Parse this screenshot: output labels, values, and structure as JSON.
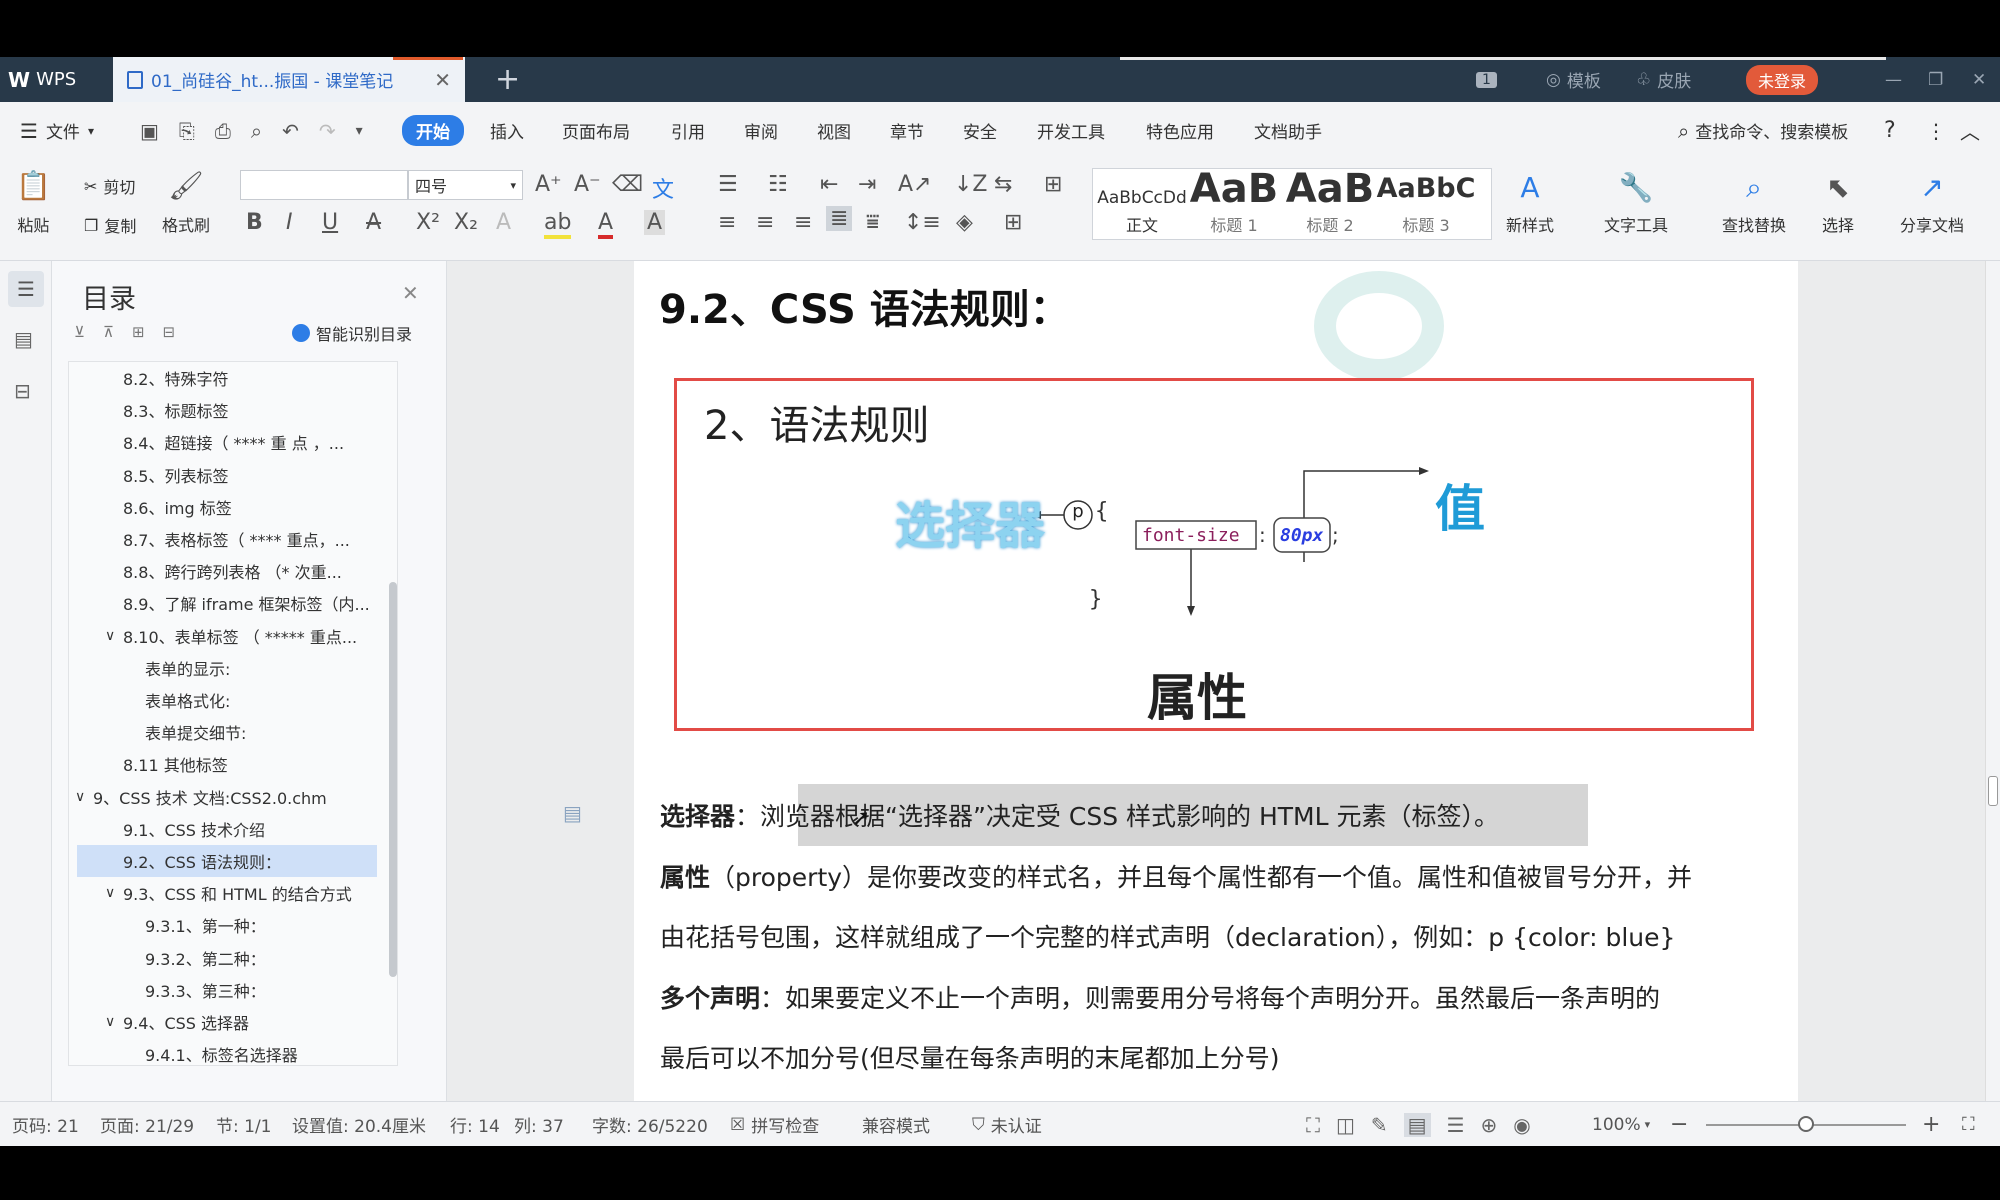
{
  "titlebar": {
    "app_name": "WPS",
    "doc_tab": "01_尚硅谷_ht...振国 - 课堂笔记",
    "new_tab": "+",
    "window_count": "1",
    "template": "模板",
    "skin": "皮肤",
    "login": "未登录"
  },
  "menubar": {
    "file": "文件",
    "tabs": [
      "开始",
      "插入",
      "页面布局",
      "引用",
      "审阅",
      "视图",
      "章节",
      "安全",
      "开发工具",
      "特色应用",
      "文档助手"
    ],
    "search": "查找命令、搜索模板",
    "help": "?"
  },
  "ribbon": {
    "paste": "粘贴",
    "cut": "剪切",
    "copy": "复制",
    "format_painter": "格式刷",
    "font_name": "",
    "font_size": "四号",
    "styles": [
      {
        "preview": "AaBbCcDd",
        "label": "正文"
      },
      {
        "preview": "AaB",
        "label": "标题 1"
      },
      {
        "preview": "AaB",
        "label": "标题 2"
      },
      {
        "preview": "AaBbC",
        "label": "标题 3"
      }
    ],
    "new_style": "新样式",
    "text_tools": "文字工具",
    "find_replace": "查找替换",
    "select": "选择",
    "share": "分享文档"
  },
  "toc": {
    "title": "目录",
    "smart": "智能识别目录",
    "items": [
      {
        "label": "8.2、特殊字符",
        "level": 2
      },
      {
        "label": "8.3、标题标签",
        "level": 2
      },
      {
        "label": "8.4、超链接（ **** 重 点 ，...",
        "level": 2
      },
      {
        "label": "8.5、列表标签",
        "level": 2
      },
      {
        "label": "8.6、img 标签",
        "level": 2
      },
      {
        "label": "8.7、表格标签（ **** 重点，...",
        "level": 2
      },
      {
        "label": "8.8、跨行跨列表格 （* 次重...",
        "level": 2
      },
      {
        "label": "8.9、了解 iframe 框架标签（内...",
        "level": 2
      },
      {
        "label": "8.10、表单标签 （ ***** 重点...",
        "level": 2
      },
      {
        "label": "表单的显示:",
        "level": 3
      },
      {
        "label": "表单格式化:",
        "level": 3
      },
      {
        "label": "表单提交细节:",
        "level": 3
      },
      {
        "label": "8.11 其他标签",
        "level": 2
      },
      {
        "label": "9、CSS 技术    文档:CSS2.0.chm",
        "level": 1
      },
      {
        "label": "9.1、CSS 技术介绍",
        "level": 2
      },
      {
        "label": "9.2、CSS 语法规则：",
        "level": 2
      },
      {
        "label": "9.3、CSS 和 HTML 的结合方式",
        "level": 2
      },
      {
        "label": "9.3.1、第一种：",
        "level": 3
      },
      {
        "label": "9.3.2、第二种：",
        "level": 3
      },
      {
        "label": "9.3.3、第三种：",
        "level": 3
      },
      {
        "label": "9.4、CSS 选择器",
        "level": 2
      },
      {
        "label": "9.4.1、标签名选择器",
        "level": 3
      }
    ]
  },
  "document": {
    "heading": "9.2、CSS 语法规则：",
    "slide": {
      "title": "2、语法规则",
      "selector_label": "选择器",
      "value_label": "值",
      "property_label": "属性",
      "code_p": "p",
      "code_open": "{",
      "code_prop": "font-size",
      "code_colon": ":",
      "code_value": "80px",
      "code_semi": ";",
      "code_close": "}"
    },
    "para1_bold": "选择器",
    "para1_rest": "：浏览器根据“选择器”决定受 CSS 样式影响的 HTML 元素（标签）。",
    "para2_bold": "属性",
    "para2_rest": "（property）是你要改变的样式名，并且每个属性都有一个值。属性和值被冒号分开，并",
    "para3": "由花括号包围，这样就组成了一个完整的样式声明（declaration），例如：p {color: blue}",
    "para4_bold": "多个声明",
    "para4_rest": "：如果要定义不止一个声明，则需要用分号将每个声明分开。虽然最后一条声明的",
    "para5": "最后可以不加分号(但尽量在每条声明的末尾都加上分号)"
  },
  "statusbar": {
    "page_no": "页码: 21",
    "pages": "页面: 21/29",
    "section": "节: 1/1",
    "setting": "设置值: 20.4厘米",
    "row": "行: 14",
    "col": "列: 37",
    "word_count": "字数: 26/5220",
    "spell_check": "拼写检查",
    "compat": "兼容模式",
    "cert": "未认证",
    "zoom": "100%"
  }
}
